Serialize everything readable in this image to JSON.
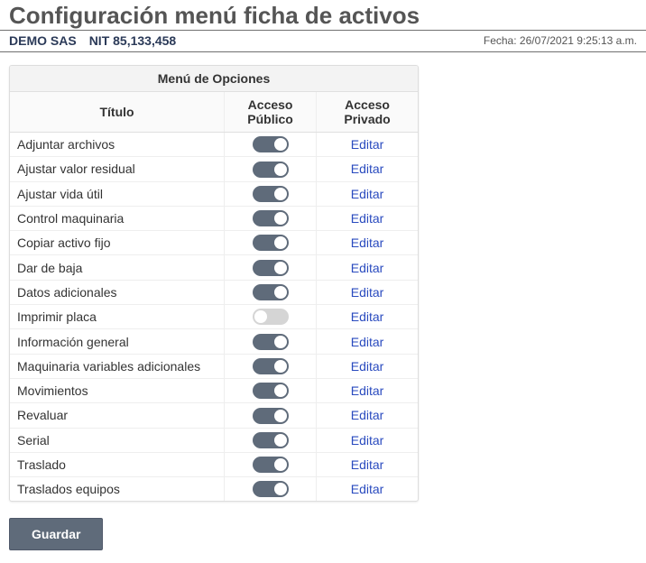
{
  "page_title": "Configuración menú ficha de activos",
  "header": {
    "company": "DEMO SAS",
    "nit_label": "NIT",
    "nit_value": "85,133,458",
    "date_label": "Fecha:",
    "date_value": "26/07/2021 9:25:13 a.m."
  },
  "table": {
    "group_header": "Menú de Opciones",
    "col_title": "Título",
    "col_public": "Acceso Público",
    "col_private": "Acceso Privado",
    "edit_label": "Editar",
    "rows": [
      {
        "title": "Adjuntar archivos",
        "public_on": true
      },
      {
        "title": "Ajustar valor residual",
        "public_on": true
      },
      {
        "title": "Ajustar vida útil",
        "public_on": true
      },
      {
        "title": "Control maquinaria",
        "public_on": true
      },
      {
        "title": "Copiar activo fijo",
        "public_on": true
      },
      {
        "title": "Dar de baja",
        "public_on": true
      },
      {
        "title": "Datos adicionales",
        "public_on": true
      },
      {
        "title": "Imprimir placa",
        "public_on": false
      },
      {
        "title": "Información general",
        "public_on": true
      },
      {
        "title": "Maquinaria variables adicionales",
        "public_on": true
      },
      {
        "title": "Movimientos",
        "public_on": true
      },
      {
        "title": "Revaluar",
        "public_on": true
      },
      {
        "title": "Serial",
        "public_on": true
      },
      {
        "title": "Traslado",
        "public_on": true
      },
      {
        "title": "Traslados equipos",
        "public_on": true
      }
    ]
  },
  "save_label": "Guardar"
}
